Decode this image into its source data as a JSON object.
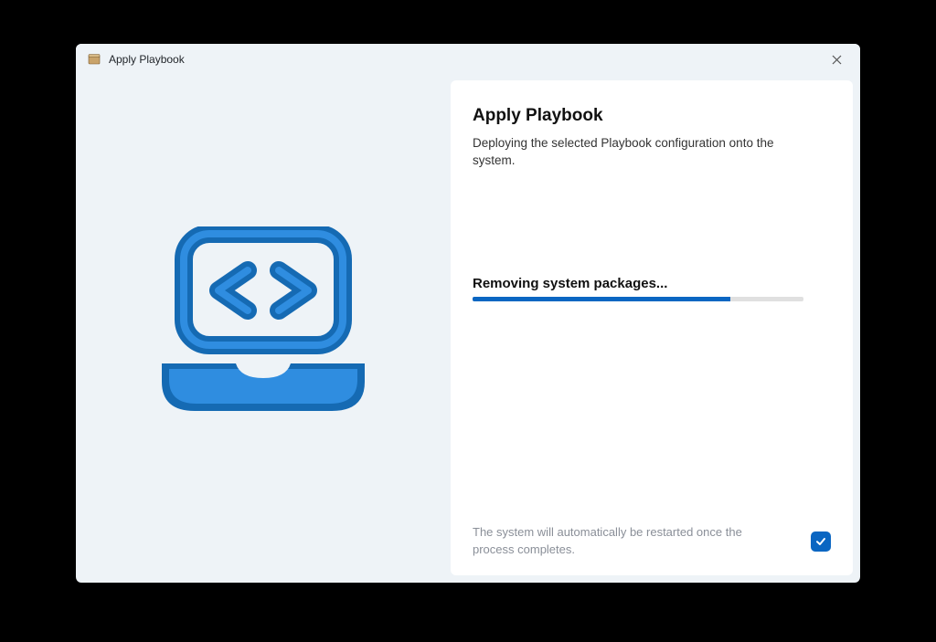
{
  "titlebar": {
    "title": "Apply Playbook"
  },
  "panel": {
    "heading": "Apply Playbook",
    "description": "Deploying the selected Playbook configuration onto the system."
  },
  "progress": {
    "status_label": "Removing system packages...",
    "percent": 78
  },
  "footer": {
    "restart_note": "The system will automatically be restarted once the process completes.",
    "auto_restart_checked": true
  },
  "colors": {
    "accent": "#0a66c2",
    "pane_bg": "#eef3f7"
  }
}
